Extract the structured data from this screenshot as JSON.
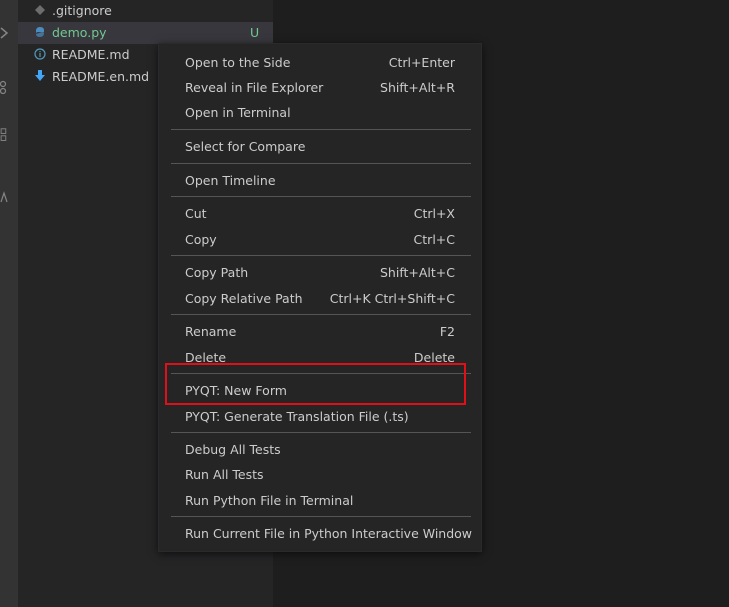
{
  "explorer": {
    "files": [
      {
        "name": ".gitignore",
        "icon": "gitignore-icon",
        "status": ""
      },
      {
        "name": "demo.py",
        "icon": "python-icon",
        "status": "U",
        "selected": true
      },
      {
        "name": "README.md",
        "icon": "info-icon",
        "status": ""
      },
      {
        "name": "README.en.md",
        "icon": "markdown-download-icon",
        "status": ""
      }
    ]
  },
  "context_menu": {
    "groups": [
      [
        {
          "label": "Open to the Side",
          "shortcut": "Ctrl+Enter"
        },
        {
          "label": "Reveal in File Explorer",
          "shortcut": "Shift+Alt+R"
        },
        {
          "label": "Open in Terminal",
          "shortcut": ""
        }
      ],
      [
        {
          "label": "Select for Compare",
          "shortcut": ""
        }
      ],
      [
        {
          "label": "Open Timeline",
          "shortcut": ""
        }
      ],
      [
        {
          "label": "Cut",
          "shortcut": "Ctrl+X"
        },
        {
          "label": "Copy",
          "shortcut": "Ctrl+C"
        }
      ],
      [
        {
          "label": "Copy Path",
          "shortcut": "Shift+Alt+C"
        },
        {
          "label": "Copy Relative Path",
          "shortcut": "Ctrl+K Ctrl+Shift+C"
        }
      ],
      [
        {
          "label": "Rename",
          "shortcut": "F2"
        },
        {
          "label": "Delete",
          "shortcut": "Delete"
        }
      ],
      [
        {
          "label": "PYQT: New Form",
          "shortcut": ""
        },
        {
          "label": "PYQT: Generate Translation File (.ts)",
          "shortcut": ""
        }
      ],
      [
        {
          "label": "Debug All Tests",
          "shortcut": ""
        },
        {
          "label": "Run All Tests",
          "shortcut": ""
        },
        {
          "label": "Run Python File in Terminal",
          "shortcut": ""
        }
      ],
      [
        {
          "label": "Run Current File in Python Interactive Window",
          "shortcut": ""
        }
      ]
    ]
  },
  "colors": {
    "highlight_box": "#e0101a",
    "untracked_status": "#73c991",
    "python_icon": "#4b8bbe",
    "info_icon": "#519aba",
    "markdown_icon": "#42a5f5"
  }
}
